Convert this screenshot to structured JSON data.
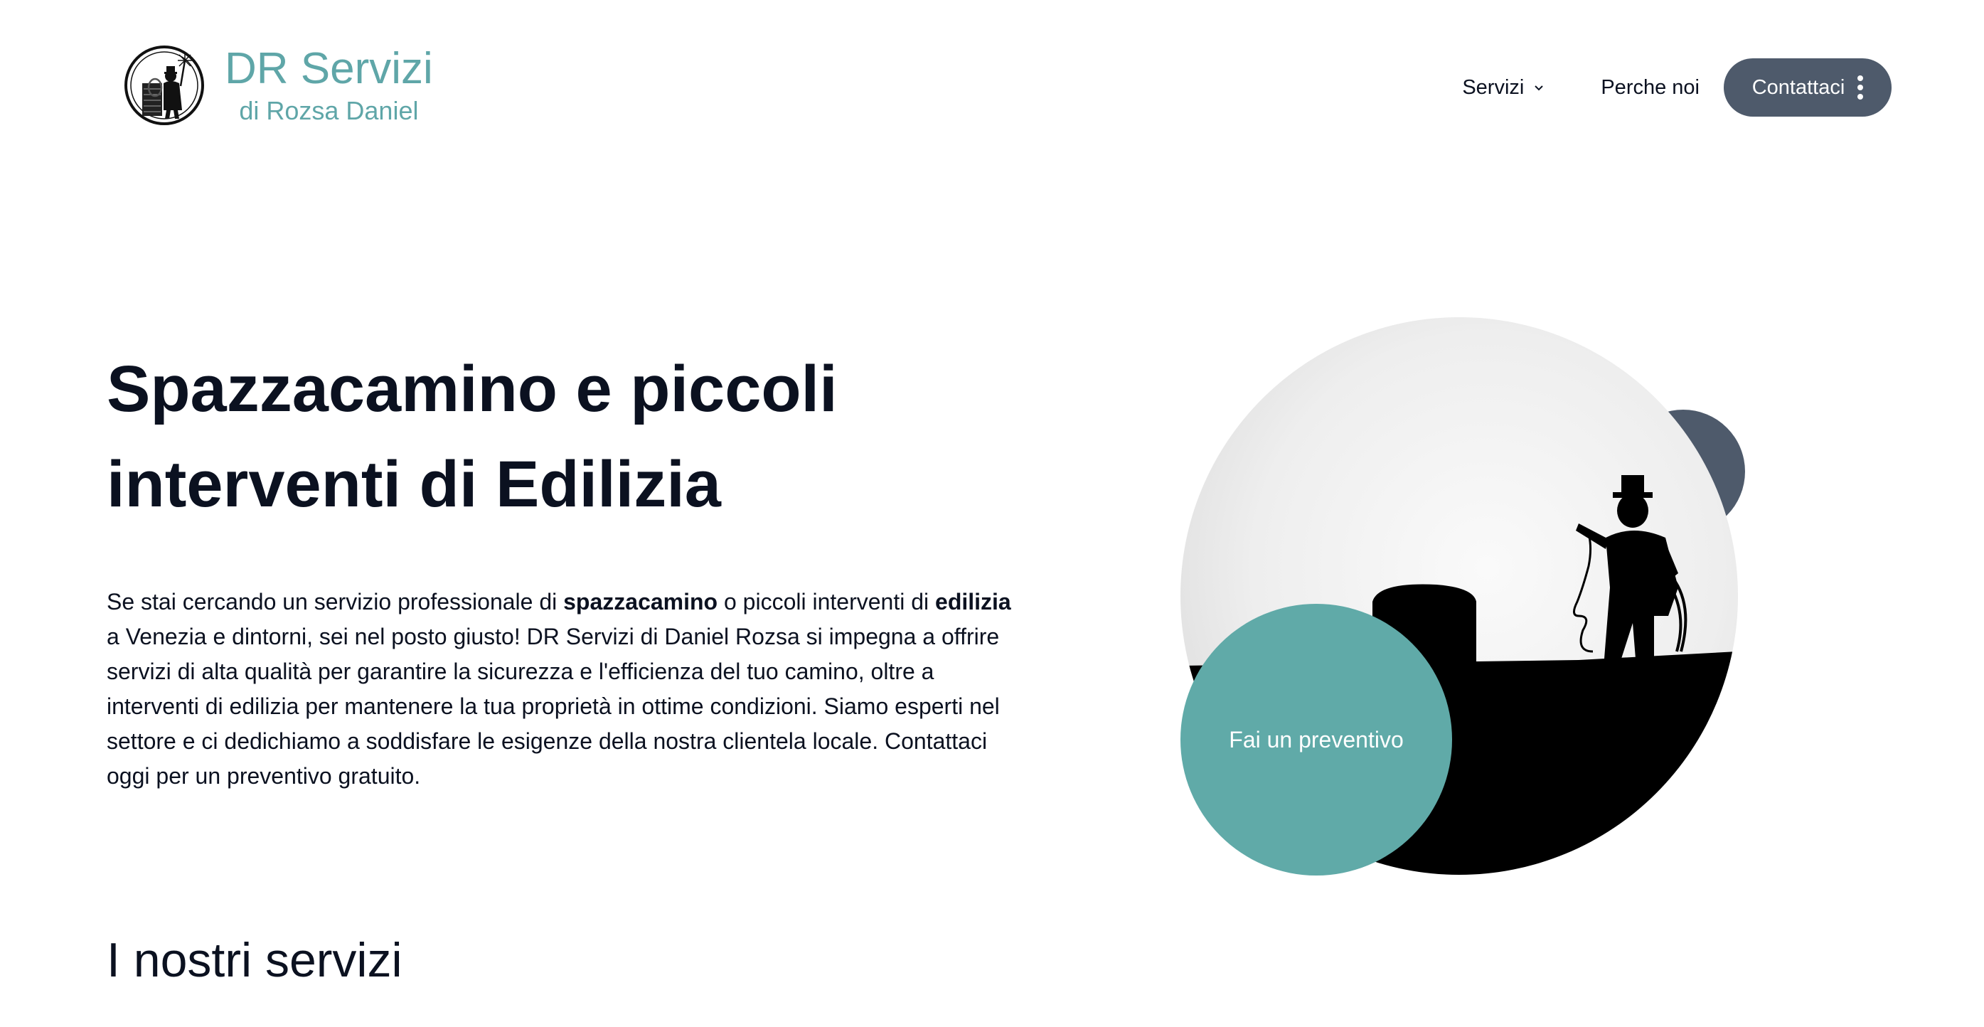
{
  "header": {
    "brand_name": "DR Servizi",
    "brand_sub": "di Rozsa Daniel",
    "logo_icon": "chimney-sweep-logo-icon",
    "nav": {
      "servizi": "Servizi",
      "perche": "Perche noi",
      "contact": "Contattaci"
    }
  },
  "hero": {
    "title_line1": "Spazzacamino e piccoli",
    "title_line2": "interventi di Edilizia",
    "p1": "Se stai cercando un servizio professionale di ",
    "b1": "spazzacamino",
    "p2": " o piccoli interventi di ",
    "b2": "edilizia",
    "p3": " a Venezia e dintorni, sei nel posto giusto! DR Servizi di Daniel Rozsa si impegna a offrire servizi di alta qualità per garantire la sicurezza e l'efficienza del tuo camino, oltre a interventi di edilizia per mantenere la tua proprietà in ottime condizioni. Siamo esperti nel settore e ci dedichiamo a soddisfare le esigenze della nostra clientela locale. Contattaci oggi per un preventivo gratuito.",
    "cta": "Fai un preventivo"
  },
  "services": {
    "title": "I nostri servizi"
  },
  "colors": {
    "brand": "#5fa6a8",
    "dark": "#4e5a6b",
    "cta": "#60aaa8",
    "text": "#0b1120"
  }
}
